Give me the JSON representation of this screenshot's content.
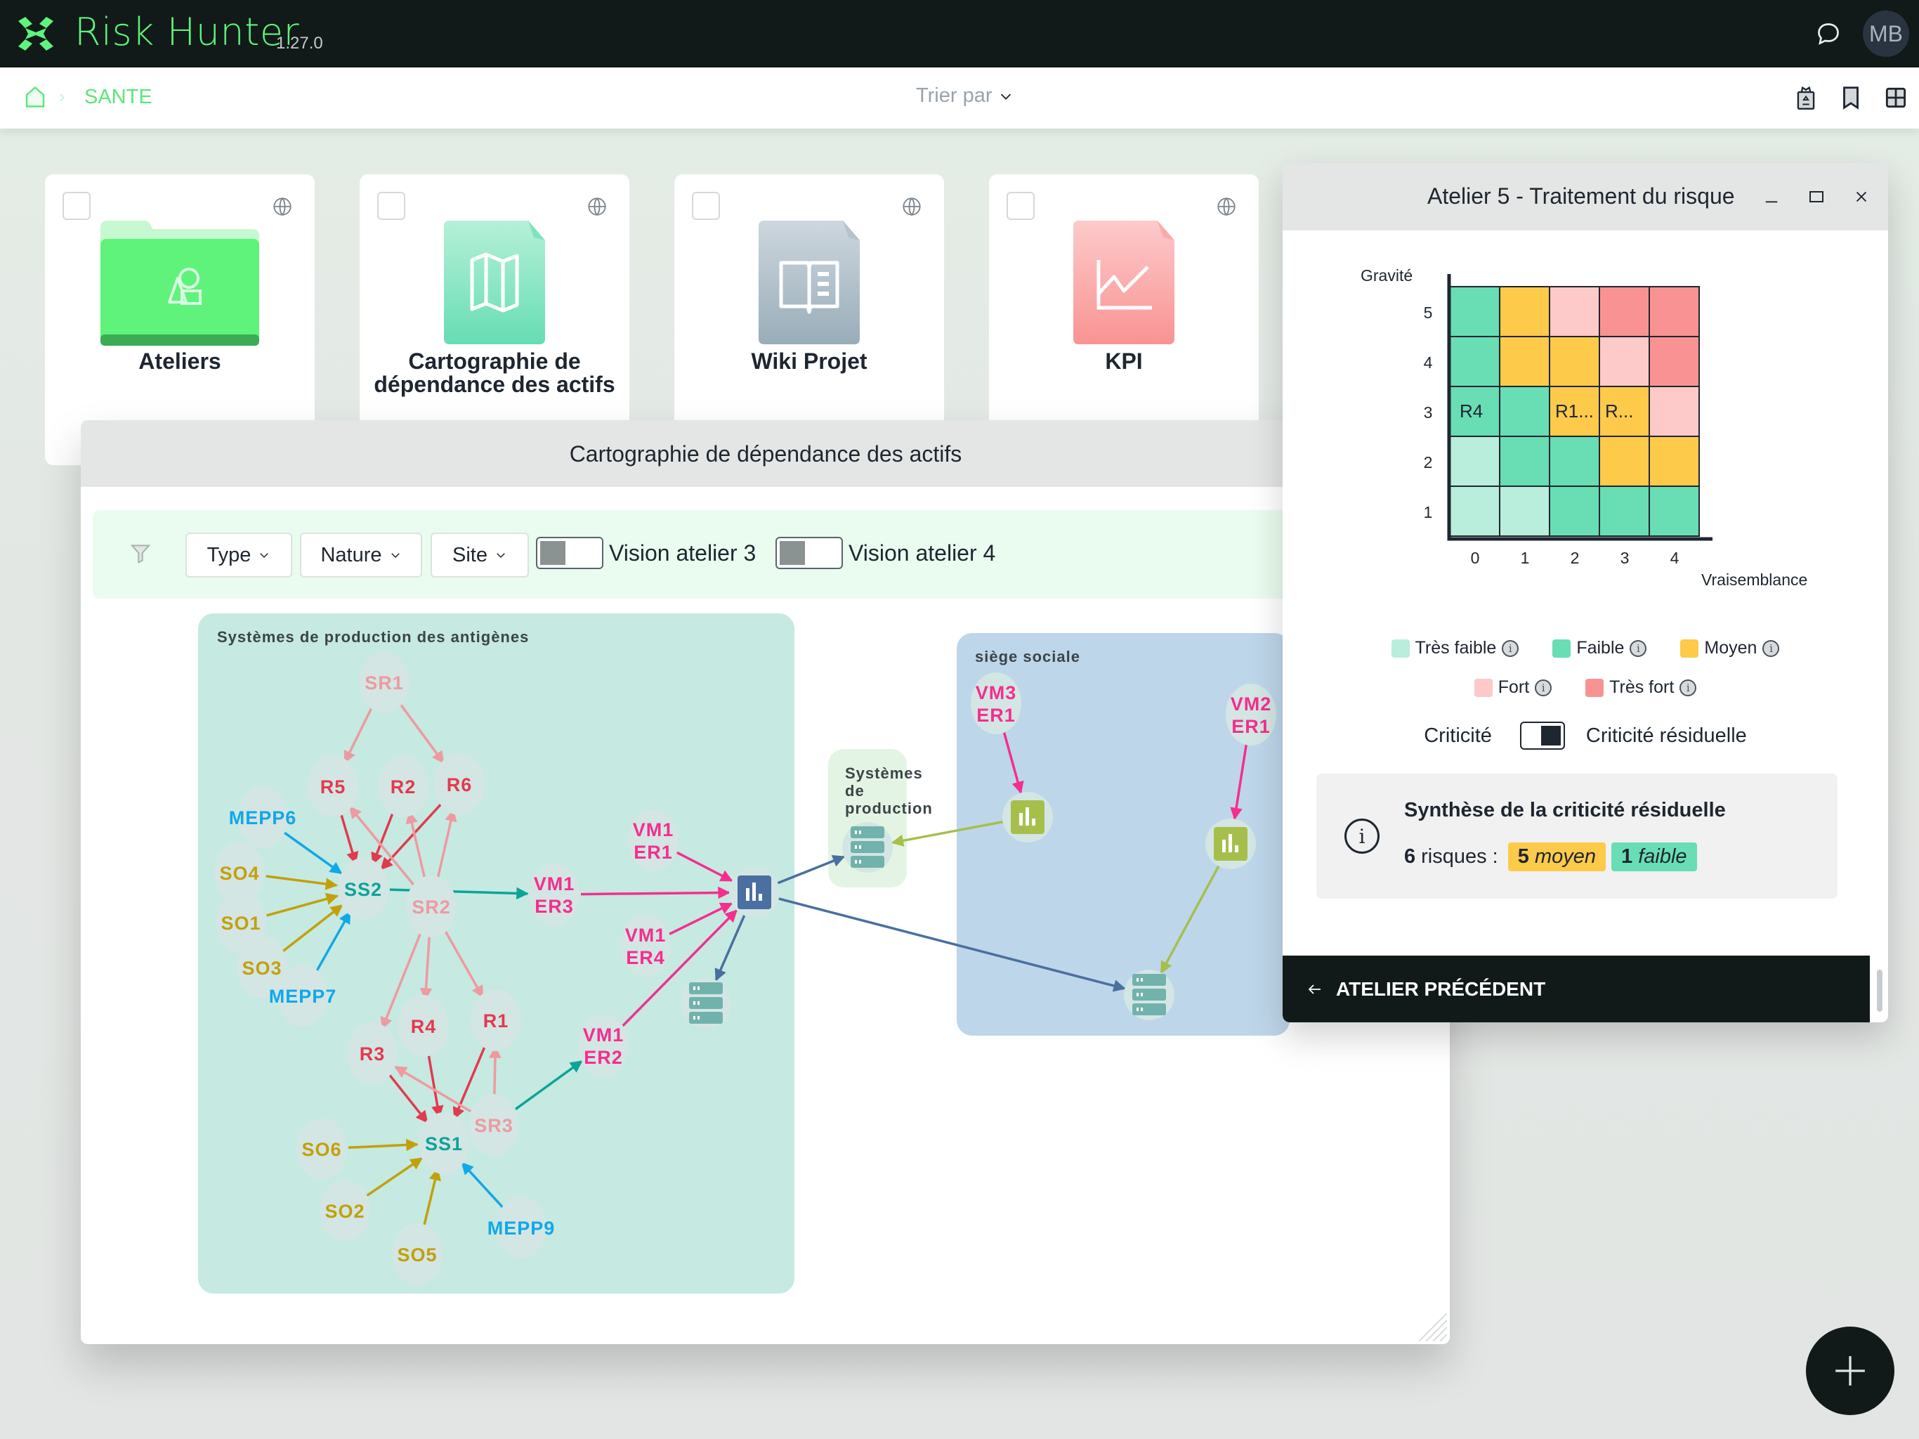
{
  "app": {
    "name": "Risk Hunter",
    "version": "1.27.0",
    "avatar_initials": "MB",
    "brand_color": "#5ff37c"
  },
  "breadcrumb": {
    "items": [
      "SANTE"
    ]
  },
  "toolbar": {
    "sort_label": "Trier par",
    "icons": [
      "recycle-bin-icon",
      "bookmark-icon",
      "grid-view-icon"
    ]
  },
  "cards": [
    {
      "label": "Ateliers",
      "icon": "folder-shapes-icon",
      "color": "#5ff37c"
    },
    {
      "label": "Cartographie de dépendance des actifs",
      "icon": "map-document-icon",
      "color": "#6ddfb6"
    },
    {
      "label": "Wiki Projet",
      "icon": "book-document-icon",
      "color": "#a3b5c1"
    },
    {
      "label": "KPI",
      "icon": "chart-document-icon",
      "color": "#fb9a9a"
    }
  ],
  "carto_window": {
    "title": "Cartographie de dépendance des actifs",
    "filters": [
      {
        "label": "Type"
      },
      {
        "label": "Nature"
      },
      {
        "label": "Site"
      }
    ],
    "toggles": [
      {
        "label": "Vision atelier 3",
        "on": false
      },
      {
        "label": "Vision atelier 4",
        "on": false
      }
    ],
    "groups": [
      {
        "label": "Systèmes de production des antigènes"
      },
      {
        "label": "Systèmes de production"
      },
      {
        "label": "siège sociale"
      }
    ],
    "nodes": {
      "SR1": "SR1",
      "R5": "R5",
      "R2": "R2",
      "R6": "R6",
      "MEPP6": "MEPP6",
      "SO4": "SO4",
      "SO1": "SO1",
      "SO3": "SO3",
      "MEPP7": "MEPP7",
      "SS2": "SS2",
      "SR2": "SR2",
      "VM1ER3": [
        "VM1",
        "ER3"
      ],
      "VM1ER1": [
        "VM1",
        "ER1"
      ],
      "VM1ER4": [
        "VM1",
        "ER4"
      ],
      "VM1ER2": [
        "VM1",
        "ER2"
      ],
      "R4": "R4",
      "R1": "R1",
      "R3": "R3",
      "SR3": "SR3",
      "SS1": "SS1",
      "SO6": "SO6",
      "SO2": "SO2",
      "SO5": "SO5",
      "MEPP9": "MEPP9",
      "VM3ER1": [
        "VM3",
        "ER1"
      ],
      "VM2ER1": [
        "VM2",
        "ER1"
      ]
    },
    "colors": {
      "risk": "#e23a4e",
      "risk_source": "#ee9aa0",
      "measure": "#11a8e8",
      "objective": "#c3a00a",
      "support": "#0ea398",
      "vm": "#f52e8f",
      "app_blue": "#4a6fa0",
      "app_green": "#a6bf4b",
      "server": "#72b2ac"
    }
  },
  "risk_panel": {
    "title": "Atelier 5 - Traitement du risque",
    "controls": [
      "minimize-icon",
      "maximize-icon",
      "close-icon"
    ],
    "chart_data": {
      "type": "heatmap",
      "title": "",
      "xlabel": "Vraisemblance",
      "ylabel": "Gravité",
      "x_ticks": [
        "0",
        "1",
        "2",
        "3",
        "4"
      ],
      "y_ticks": [
        "5",
        "4",
        "3",
        "2",
        "1"
      ],
      "levels": {
        "TF": {
          "name": "Très faible",
          "color": "#b8eedb"
        },
        "F": {
          "name": "Faible",
          "color": "#69ddb4"
        },
        "M": {
          "name": "Moyen",
          "color": "#fdca4a"
        },
        "Fo": {
          "name": "Fort",
          "color": "#fdc9c9"
        },
        "TFo": {
          "name": "Très fort",
          "color": "#f99393"
        }
      },
      "grid": [
        [
          "F",
          "M",
          "Fo",
          "TFo",
          "TFo"
        ],
        [
          "F",
          "M",
          "M",
          "Fo",
          "TFo"
        ],
        [
          "F",
          "F",
          "M",
          "M",
          "Fo"
        ],
        [
          "TF",
          "F",
          "F",
          "M",
          "M"
        ],
        [
          "TF",
          "TF",
          "F",
          "F",
          "F"
        ]
      ],
      "cell_labels": [
        {
          "gravite": 3,
          "vraisemblance": 0,
          "text": "R4"
        },
        {
          "gravite": 3,
          "vraisemblance": 2,
          "text": "R1..."
        },
        {
          "gravite": 3,
          "vraisemblance": 3,
          "text": "R..."
        }
      ]
    },
    "legend": [
      {
        "label": "Très faible",
        "color": "#b8eedb"
      },
      {
        "label": "Faible",
        "color": "#69ddb4"
      },
      {
        "label": "Moyen",
        "color": "#fdca4a"
      },
      {
        "label": "Fort",
        "color": "#fdc9c9"
      },
      {
        "label": "Très fort",
        "color": "#f99393"
      }
    ],
    "criticity_toggle": {
      "left_label": "Criticité",
      "right_label": "Criticité résiduelle",
      "selected": "Criticité résiduelle"
    },
    "synthesis": {
      "title": "Synthèse de la criticité résiduelle",
      "total_count": "6",
      "total_label": "risques :",
      "badges": [
        {
          "count": "5",
          "label": "moyen",
          "color": "#fdca4a"
        },
        {
          "count": "1",
          "label": "faible",
          "color": "#69ddb4"
        }
      ]
    },
    "prev_button": "ATELIER PRÉCÉDENT"
  },
  "fab": {
    "icon": "plus-icon"
  }
}
